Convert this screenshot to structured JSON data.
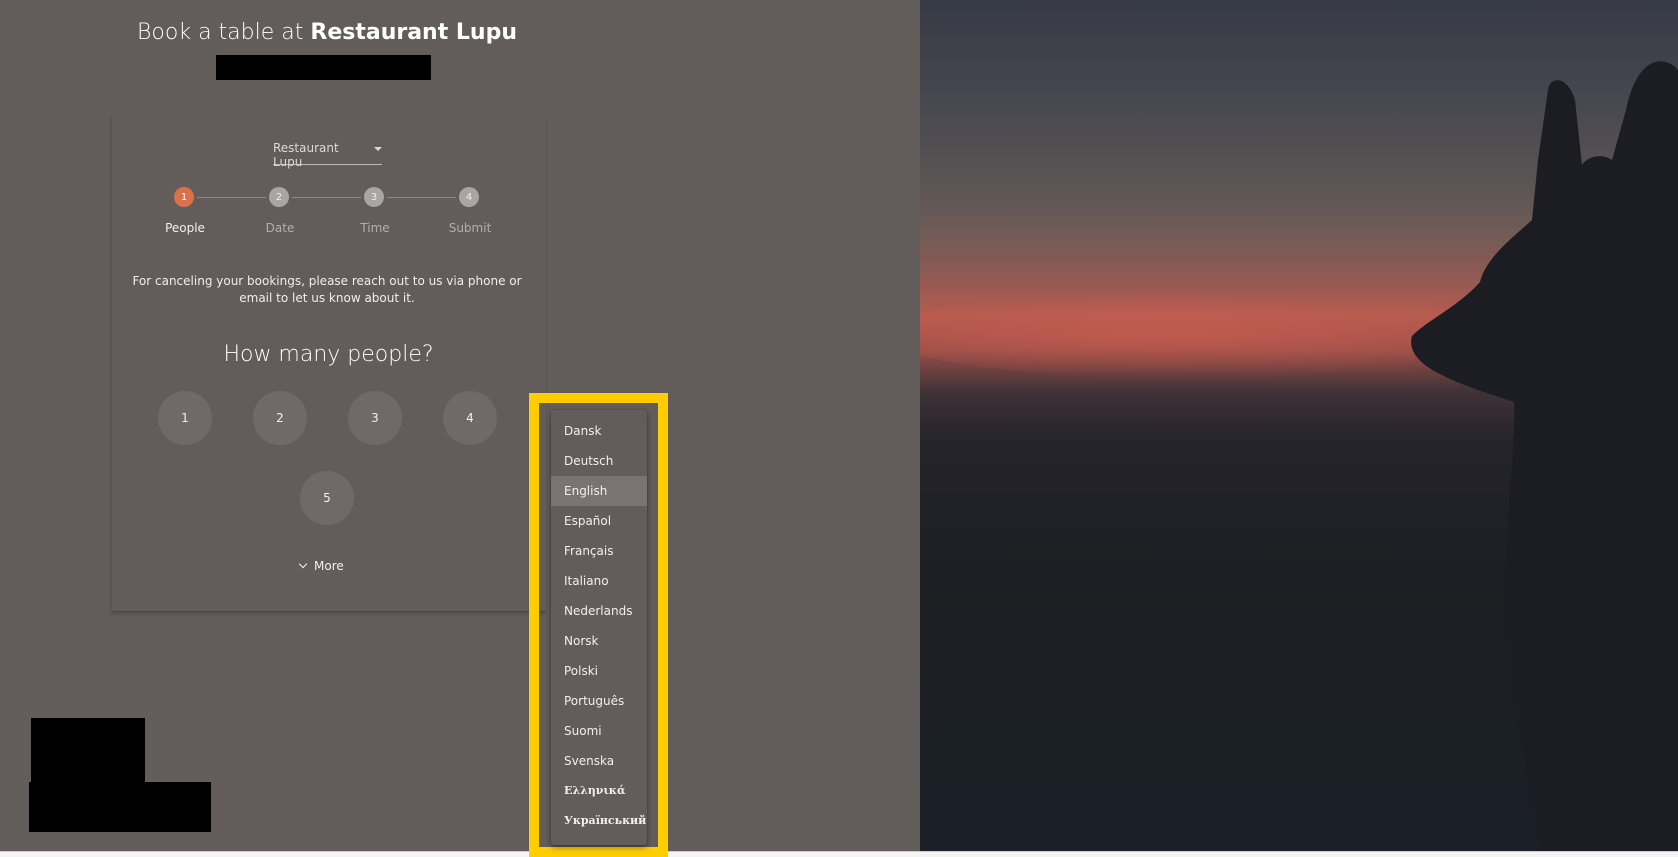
{
  "header": {
    "title_prefix": "Book a table at ",
    "title_name": "Restaurant Lupu"
  },
  "restaurant_select": {
    "value": "Restaurant Lupu"
  },
  "stepper": {
    "steps": [
      {
        "number": "1",
        "label": "People",
        "active": true
      },
      {
        "number": "2",
        "label": "Date",
        "active": false
      },
      {
        "number": "3",
        "label": "Time",
        "active": false
      },
      {
        "number": "4",
        "label": "Submit",
        "active": false
      }
    ],
    "active_color": "#d9714a"
  },
  "notice": "For canceling your bookings, please reach out to us via phone or email to let us know about it.",
  "question": "How many people?",
  "people_options": [
    "1",
    "2",
    "3",
    "4",
    "5"
  ],
  "more_label": "More",
  "language_menu": {
    "selected": "English",
    "items": [
      "Dansk",
      "Deutsch",
      "English",
      "Español",
      "Français",
      "Italiano",
      "Nederlands",
      "Norsk",
      "Polski",
      "Português",
      "Suomi",
      "Svenska",
      "Ελληνικά",
      "Український"
    ]
  },
  "colors": {
    "background": "#625c5b",
    "highlight": "#ffcd00"
  }
}
